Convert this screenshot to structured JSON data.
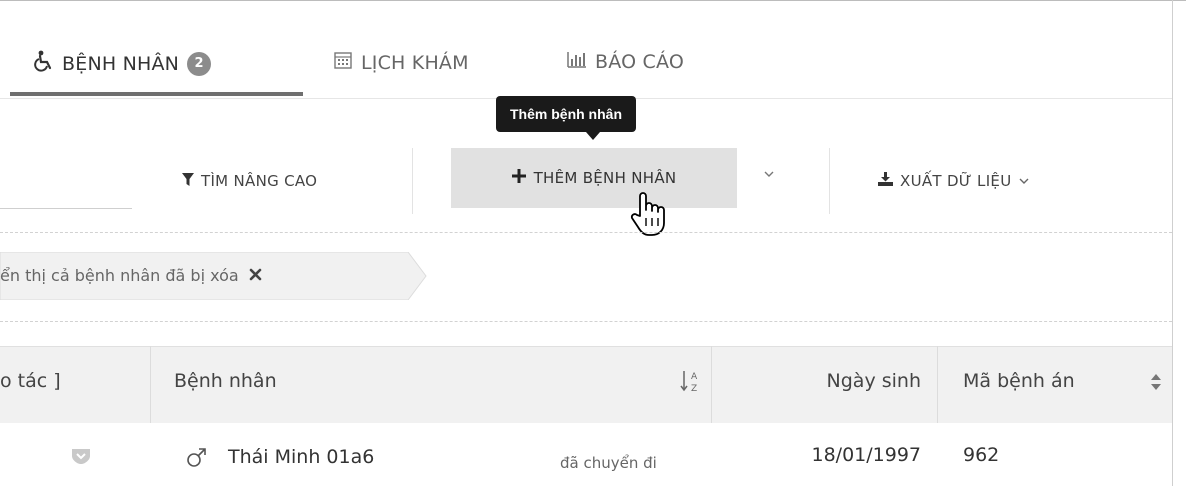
{
  "tabs": [
    {
      "label": "BỆNH NHÂN",
      "badge": "2",
      "icon": "wheelchair-icon",
      "active": true
    },
    {
      "label": "LỊCH KHÁM",
      "icon": "calendar-icon",
      "active": false
    },
    {
      "label": "BÁO CÁO",
      "icon": "bar-chart-icon",
      "active": false
    }
  ],
  "tooltip": {
    "text": "Thêm bệnh nhân"
  },
  "toolbar": {
    "advanced_search_label": "TÌM NÂNG CAO",
    "add_patient_label": "THÊM BỆNH NHÂN",
    "export_label": "XUẤT DỮ LIỆU"
  },
  "filter_chip": {
    "text": "ển thị cả bệnh nhân đã bị xóa"
  },
  "table": {
    "headers": {
      "actions": "o tác ]",
      "patient": "Bệnh nhân",
      "dob": "Ngày sinh",
      "record_id": "Mã bệnh án"
    },
    "rows": [
      {
        "gender_icon": "male-icon",
        "name": "Thái Minh 01a6",
        "status": "đã chuyển đi",
        "dob": "18/01/1997",
        "record_id": "962"
      }
    ]
  },
  "colors": {
    "tab_underline": "#6f6f6f",
    "button_hover_bg": "#e1e1e1",
    "tooltip_bg": "#1a1a1a",
    "header_bg": "#f1f1f1"
  }
}
